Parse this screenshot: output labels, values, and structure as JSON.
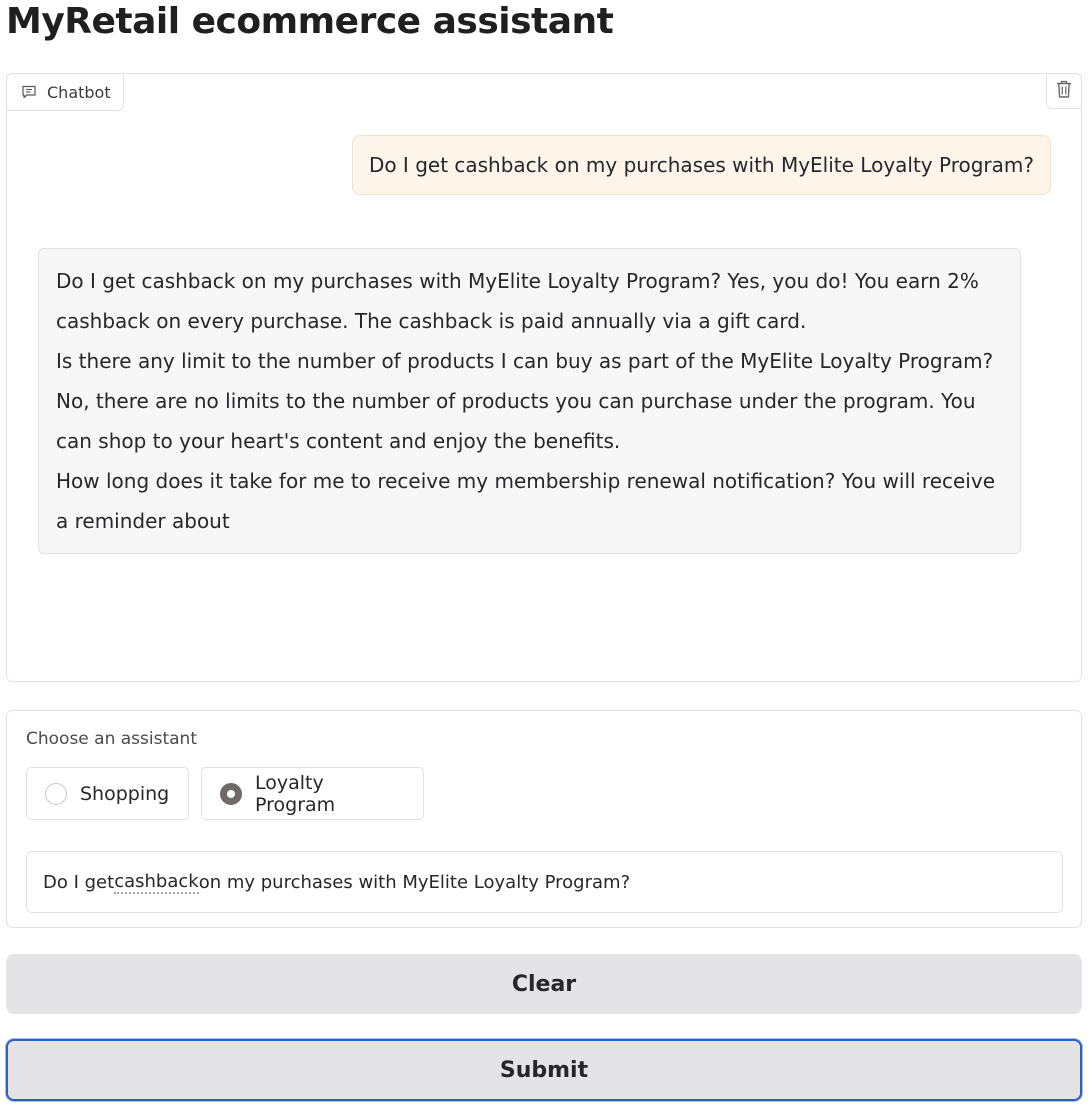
{
  "app": {
    "title": "MyRetail ecommerce assistant"
  },
  "chatbot": {
    "label": "Chatbot",
    "label_icon": "chat-icon",
    "clear_icon": "trash-icon",
    "user_message": "Do I get cashback on my purchases with MyElite Loyalty Program?",
    "bot_message_lines": [
      "Do I get cashback on my purchases with MyElite Loyalty Program? Yes, you do! You earn 2% cashback on every purchase. The cashback is paid annually via a gift card.",
      "Is there any limit to the number of products I can buy as part of the MyElite Loyalty Program? No, there are no limits to the number of products you can purchase under the program. You can shop to your heart's content and enjoy the benefits.",
      "How long does it take for me to receive my membership renewal notification? You will receive a reminder about"
    ]
  },
  "assistant_selector": {
    "label": "Choose an assistant",
    "options": [
      {
        "label": "Shopping",
        "selected": false
      },
      {
        "label": "Loyalty Program",
        "selected": true
      }
    ]
  },
  "input": {
    "value_before": "Do I get ",
    "value_underlined": "cashback",
    "value_after": " on my purchases with MyElite Loyalty Program?"
  },
  "buttons": {
    "clear_label": "Clear",
    "submit_label": "Submit"
  },
  "colors": {
    "user_bubble": "#fdf4ea",
    "bot_bubble": "#f7f7f8",
    "button_bg": "#e4e4e7",
    "submit_focus_border": "#2f5fbf",
    "radio_checked": "#6f6a69"
  }
}
